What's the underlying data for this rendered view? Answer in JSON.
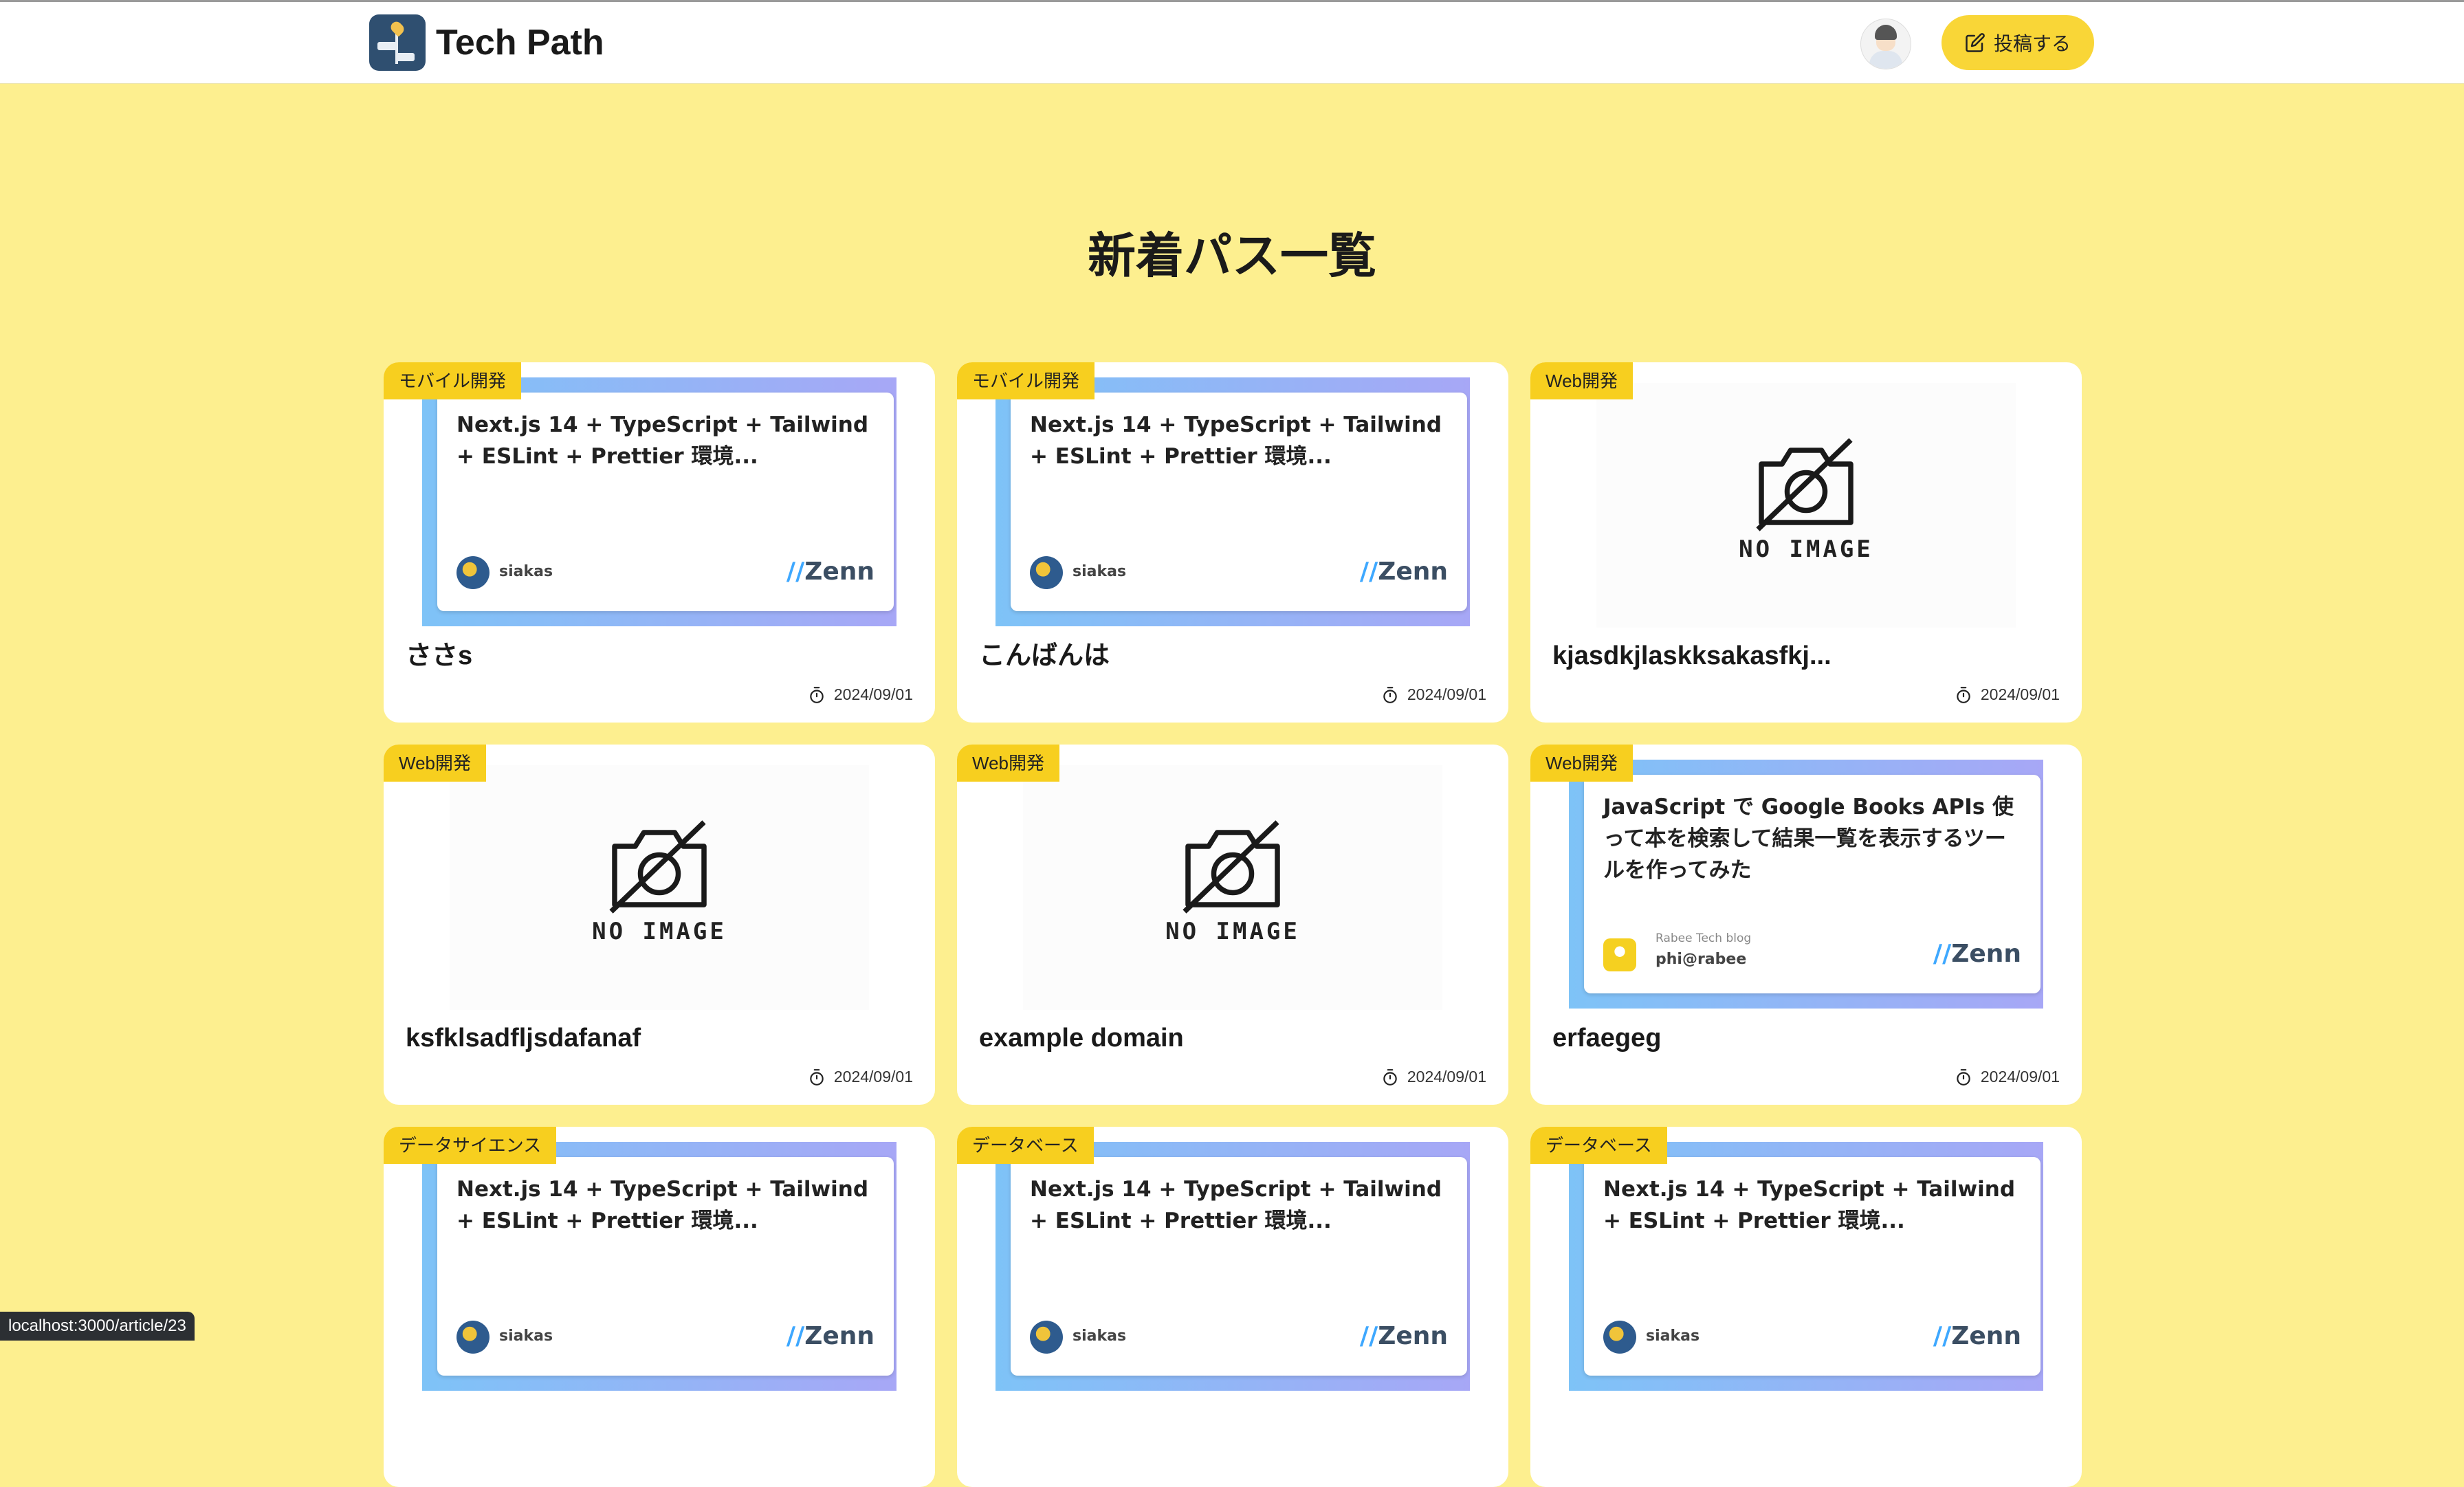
{
  "header": {
    "brand": "Tech Path",
    "post_label": "投稿する"
  },
  "page_title": "新着パス一覧",
  "no_image_text": "NO IMAGE",
  "zenn_logo": "Zenn",
  "cards": [
    {
      "tag": "モバイル開発",
      "title": "ささs",
      "date": "2024/09/01",
      "thumb": {
        "type": "zenn",
        "title": "Next.js 14 + TypeScript + Tailwind + ESLint + Prettier 環境...",
        "author": "siakas"
      }
    },
    {
      "tag": "モバイル開発",
      "title": "こんばんは",
      "date": "2024/09/01",
      "thumb": {
        "type": "zenn",
        "title": "Next.js 14 + TypeScript + Tailwind + ESLint + Prettier 環境...",
        "author": "siakas"
      }
    },
    {
      "tag": "Web開発",
      "title": "kjasdkjlaskksakasfkj...",
      "date": "2024/09/01",
      "thumb": {
        "type": "noimage"
      }
    },
    {
      "tag": "Web開発",
      "title": "ksfklsadfljsdafanaf",
      "date": "2024/09/01",
      "thumb": {
        "type": "noimage"
      }
    },
    {
      "tag": "Web開発",
      "title": "example domain",
      "date": "2024/09/01",
      "thumb": {
        "type": "noimage"
      }
    },
    {
      "tag": "Web開発",
      "title": "erfaegeg",
      "date": "2024/09/01",
      "thumb": {
        "type": "zenn",
        "title": "JavaScript で Google Books APIs 使って本を検索して結果一覧を表示するツールを作ってみた",
        "author": "phi@rabee",
        "sub": "Rabee Tech blog"
      }
    },
    {
      "tag": "データサイエンス",
      "title": "",
      "date": "",
      "thumb": {
        "type": "zenn",
        "title": "Next.js 14 + TypeScript + Tailwind + ESLint + Prettier 環境...",
        "author": "siakas"
      }
    },
    {
      "tag": "データベース",
      "title": "",
      "date": "",
      "thumb": {
        "type": "zenn",
        "title": "Next.js 14 + TypeScript + Tailwind + ESLint + Prettier 環境...",
        "author": "siakas"
      }
    },
    {
      "tag": "データベース",
      "title": "",
      "date": "",
      "thumb": {
        "type": "zenn",
        "title": "Next.js 14 + TypeScript + Tailwind + ESLint + Prettier 環境...",
        "author": "siakas"
      }
    }
  ],
  "status_bar": "localhost:3000/article/23"
}
